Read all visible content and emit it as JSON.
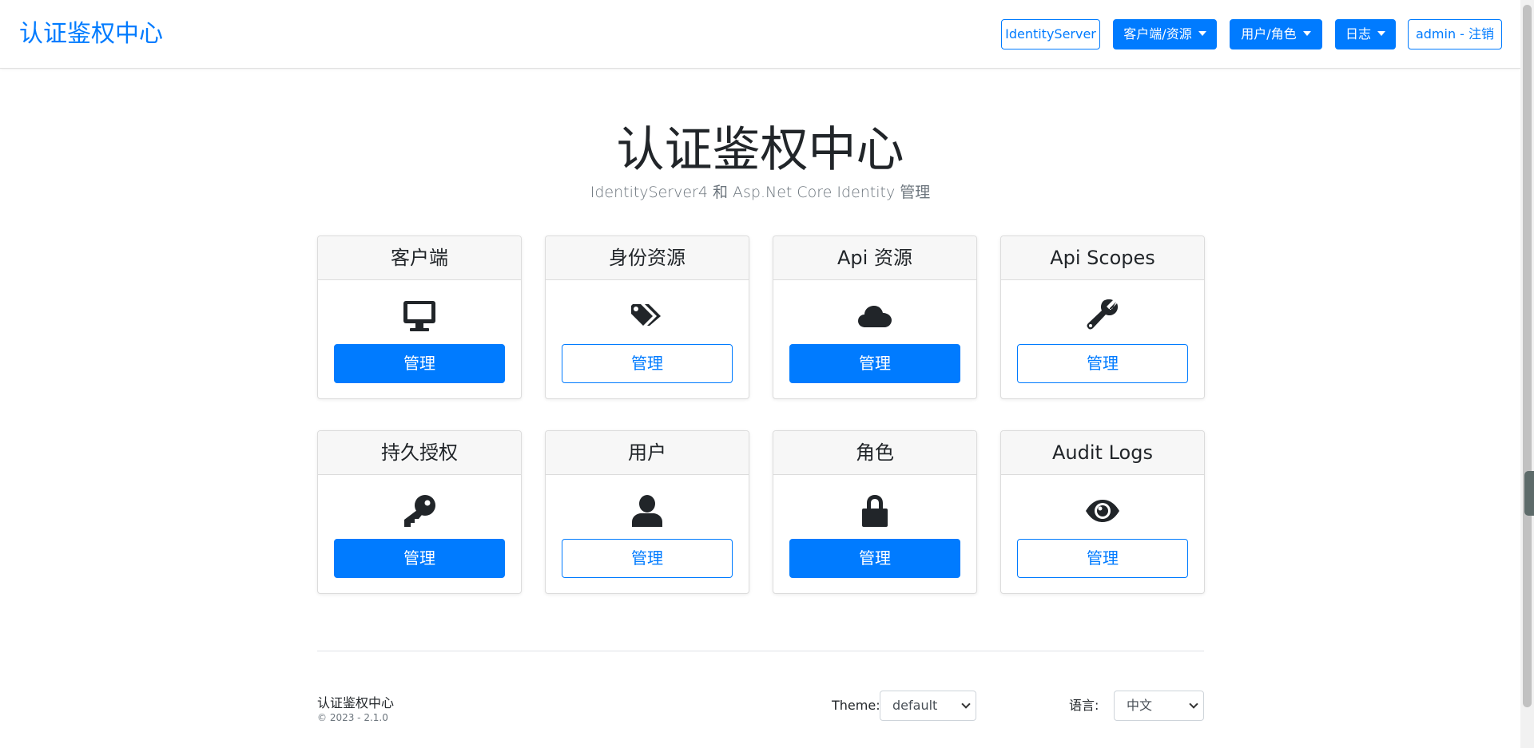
{
  "navbar": {
    "brand": "认证鉴权中心",
    "links": {
      "identityserver": "IdentityServer",
      "clients_resources": "客户端/资源",
      "users_roles": "用户/角色",
      "logs": "日志",
      "logout": "admin - 注销"
    }
  },
  "hero": {
    "title": "认证鉴权中心",
    "subtitle": "IdentityServer4 和 Asp.Net Core Identity 管理"
  },
  "cards": [
    {
      "title": "客户端",
      "icon": "desktop-icon",
      "button": "管理"
    },
    {
      "title": "身份资源",
      "icon": "tags-icon",
      "button": "管理"
    },
    {
      "title": "Api 资源",
      "icon": "cloud-icon",
      "button": "管理"
    },
    {
      "title": "Api Scopes",
      "icon": "wrench-icon",
      "button": "管理"
    },
    {
      "title": "持久授权",
      "icon": "key-icon",
      "button": "管理"
    },
    {
      "title": "用户",
      "icon": "user-icon",
      "button": "管理"
    },
    {
      "title": "角色",
      "icon": "lock-icon",
      "button": "管理"
    },
    {
      "title": "Audit Logs",
      "icon": "eye-icon",
      "button": "管理"
    }
  ],
  "footer": {
    "title": "认证鉴权中心",
    "copyright": "© 2023 - 2.1.0",
    "theme_label": "Theme:",
    "theme_value": "default",
    "language_label": "语言:",
    "language_value": "中文"
  },
  "colors": {
    "primary": "#007bff",
    "card_header_bg": "#f7f7f7",
    "text": "#212529"
  }
}
